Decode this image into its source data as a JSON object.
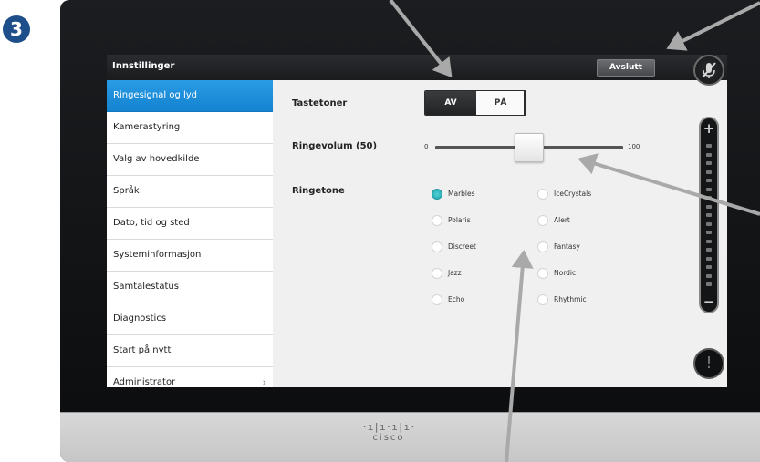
{
  "step_number": "3",
  "title": "Innstillinger",
  "exit_button": "Avslutt",
  "sidebar": {
    "items": [
      {
        "label": "Ringesignal og lyd",
        "selected": true
      },
      {
        "label": "Kamerastyring"
      },
      {
        "label": "Valg av hovedkilde"
      },
      {
        "label": "Språk"
      },
      {
        "label": "Dato, tid og sted"
      },
      {
        "label": "Systeminformasjon"
      },
      {
        "label": "Samtalestatus"
      },
      {
        "label": "Diagnostics"
      },
      {
        "label": "Start på nytt"
      },
      {
        "label": "Administrator",
        "chevron": "›"
      }
    ]
  },
  "settings": {
    "keytones": {
      "label": "Tastetoner",
      "off_label": "AV",
      "on_label": "PÅ",
      "selected": "AV"
    },
    "ring_volume": {
      "label": "Ringevolum (50)",
      "min_label": "0",
      "max_label": "100",
      "value": 50,
      "min": 0,
      "max": 100
    },
    "ringtone": {
      "label": "Ringetone",
      "options": [
        "Marbles",
        "IceCrystals",
        "Polaris",
        "Alert",
        "Discreet",
        "Fantasy",
        "Jazz",
        "Nordic",
        "Echo",
        "Rhythmic"
      ],
      "selected": "Marbles"
    }
  },
  "hardware": {
    "brand": "cisco",
    "logo_bars": "·ı|ı·ı|ı·",
    "alert_symbol": "!"
  },
  "colors": {
    "selected_blue": "#1a8fdc",
    "radio_selected": "#2bb3ba",
    "titlebar": "#1f2022"
  },
  "icons": {
    "mute": "microphone-muted-icon",
    "volume_up": "plus-icon",
    "volume_down": "minus-icon",
    "alert": "exclamation-icon"
  }
}
